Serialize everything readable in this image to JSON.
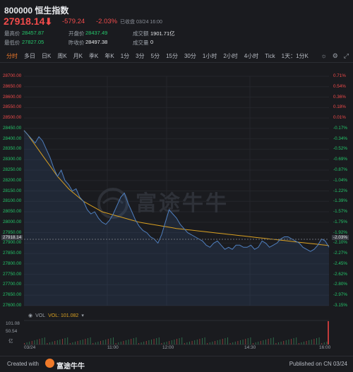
{
  "header": {
    "title": "800000 恒生指数",
    "price": "27918.14",
    "change": "-579.24",
    "change_pct": "-2.03%",
    "status": "已收盘 03/24 16:00",
    "stats": [
      {
        "label": "最高价",
        "value": "28457.87",
        "color": "green"
      },
      {
        "label": "开盘价",
        "value": "28437.49",
        "color": "green"
      },
      {
        "label": "成交额",
        "value": "1901.71亿",
        "color": "white"
      },
      {
        "label": "最低价",
        "value": "27827.05",
        "color": "green"
      },
      {
        "label": "昨收价",
        "value": "28497.38",
        "color": "white"
      },
      {
        "label": "成交量",
        "value": "0",
        "color": "white"
      }
    ]
  },
  "tabs": [
    "分时",
    "多日",
    "日K",
    "周K",
    "月K",
    "季K",
    "年K",
    "1分",
    "3分",
    "5分",
    "15分",
    "30分",
    "1小时",
    "2小时",
    "4小时",
    "Tick",
    "1天：1分K"
  ],
  "active_tab": "分时",
  "colors": {
    "up": "#f14b4b",
    "down": "#25c76b",
    "accent": "#f07a2a",
    "price_line": "#4f7fbf",
    "avg_line": "#d9a021"
  },
  "icons": [
    "sun-icon",
    "gear-icon",
    "expand-icon"
  ],
  "chart_data": {
    "type": "line",
    "ylim": [
      27600,
      28700
    ],
    "prev_close": 28497.38,
    "last_price_label": "27918.14",
    "last_pct_label": "-2.03%",
    "left_ticks": [
      "28700.00",
      "28650.00",
      "28600.00",
      "28550.00",
      "28500.00",
      "28450.00",
      "28400.00",
      "28350.00",
      "28300.00",
      "28250.00",
      "28200.00",
      "28150.00",
      "28100.00",
      "28050.00",
      "28000.00",
      "27950.00",
      "27900.00",
      "27850.00",
      "27800.00",
      "27750.00",
      "27700.00",
      "27650.00",
      "27600.00"
    ],
    "right_ticks": [
      "0.71%",
      "0.54%",
      "0.36%",
      "0.18%",
      "0.01%",
      "-0.17%",
      "-0.34%",
      "-0.52%",
      "-0.69%",
      "-0.87%",
      "-1.04%",
      "-1.22%",
      "-1.39%",
      "-1.57%",
      "-1.75%",
      "-1.92%",
      "-2.10%",
      "-2.27%",
      "-2.45%",
      "-2.62%",
      "-2.80%",
      "-2.97%",
      "-3.15%"
    ],
    "x_labels": [
      "03/24",
      "11:00",
      "12:00",
      "14:30",
      "16:00"
    ],
    "series": [
      {
        "values": [
          28440,
          28420,
          28400,
          28380,
          28410,
          28390,
          28350,
          28310,
          28260,
          28220,
          28250,
          28200,
          28180,
          28150,
          28160,
          28120,
          28100,
          28060,
          28040,
          28050,
          28020,
          28000,
          27990,
          28010,
          28040,
          28080,
          28120,
          28140,
          28090,
          28050,
          28010,
          27980,
          27960,
          27950,
          27930,
          27920,
          27900,
          27940,
          28000,
          28060,
          28040,
          28020,
          27990,
          27970,
          27950,
          27940,
          27930,
          27920,
          27910,
          27890,
          27880,
          27900,
          27910,
          27890,
          27870,
          27880,
          27870,
          27890,
          27890,
          27880,
          27880,
          27890,
          27870,
          27880,
          27910,
          27900,
          27880,
          27890,
          27900,
          27920,
          27930,
          27930,
          27920,
          27910,
          27900,
          27880,
          27870,
          27860,
          27870,
          27890,
          27920,
          27910,
          27880
        ]
      },
      {
        "values": [
          28440,
          28420,
          28395,
          28370,
          28345,
          28320,
          28295,
          28270,
          28245,
          28220,
          28200,
          28180,
          28160,
          28145,
          28130,
          28115,
          28100,
          28090,
          28080,
          28070,
          28060,
          28050,
          28045,
          28040,
          28035,
          28030,
          28025,
          28020,
          28015,
          28010,
          28005,
          28000,
          27997,
          27994,
          27991,
          27988,
          27985,
          27982,
          27979,
          27976,
          27973,
          27970,
          27968,
          27966,
          27964,
          27962,
          27960,
          27958,
          27956,
          27954,
          27952,
          27950,
          27948,
          27946,
          27944,
          27942,
          27940,
          27938,
          27936,
          27934,
          27932,
          27930,
          27928,
          27926,
          27924,
          27922,
          27920,
          27918,
          27916,
          27914,
          27912,
          27910,
          27908,
          27906,
          27904,
          27902,
          27900,
          27898,
          27896,
          27894,
          27892,
          27890,
          27888
        ]
      }
    ],
    "legend": {
      "vol_label": "VOL",
      "vol_value_label": "VOL: 101.082"
    },
    "vol_ticks": [
      "101.08",
      "50.54",
      "亿"
    ]
  },
  "watermark": "富途牛牛",
  "footer": {
    "created_with": "Created with",
    "brand": "富途牛牛",
    "published": "Published on CN 03/24"
  }
}
